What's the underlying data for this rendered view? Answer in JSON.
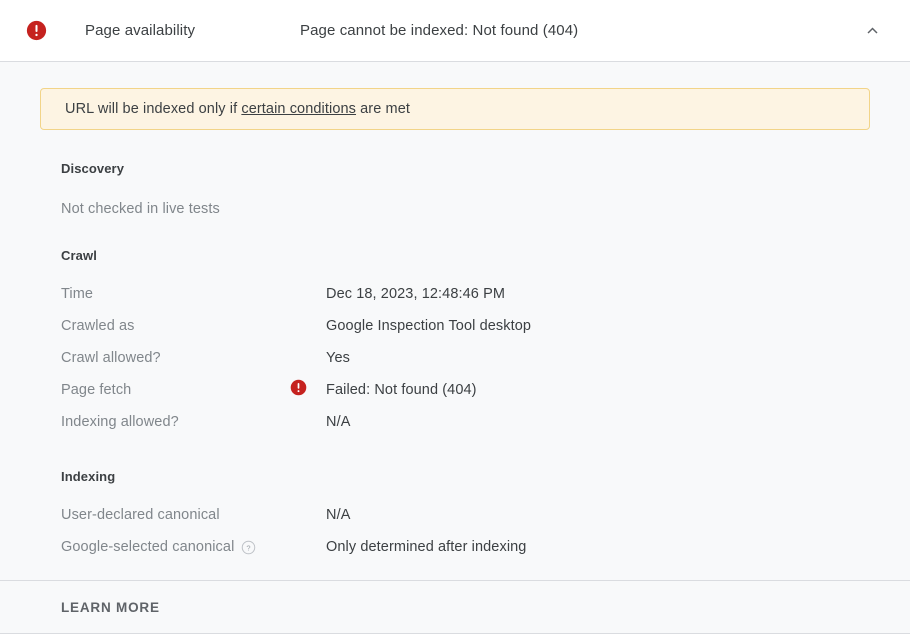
{
  "header": {
    "status_icon": "error-icon",
    "title": "Page availability",
    "status": "Page cannot be indexed: Not found (404)",
    "collapse_icon": "chevron-up-icon"
  },
  "notice": {
    "text_before": "URL will be indexed only if ",
    "link_text": "certain conditions",
    "text_after": " are met"
  },
  "sections": [
    {
      "title": "Discovery",
      "note": "Not checked in live tests"
    },
    {
      "title": "Crawl",
      "rows": [
        {
          "label": "Time",
          "value": "Dec 18, 2023, 12:48:46 PM",
          "status_icon": ""
        },
        {
          "label": "Crawled as",
          "value": "Google Inspection Tool desktop",
          "status_icon": ""
        },
        {
          "label": "Crawl allowed?",
          "value": "Yes",
          "status_icon": ""
        },
        {
          "label": "Page fetch",
          "value": "Failed: Not found (404)",
          "status_icon": "error-icon"
        },
        {
          "label": "Indexing allowed?",
          "value": "N/A",
          "status_icon": ""
        }
      ]
    },
    {
      "title": "Indexing",
      "rows": [
        {
          "label": "User-declared canonical",
          "value": "N/A",
          "status_icon": "",
          "help_icon": ""
        },
        {
          "label": "Google-selected canonical",
          "value": "Only determined after indexing",
          "status_icon": "",
          "help_icon": "help-icon"
        }
      ]
    }
  ],
  "footer": {
    "learn_more": "LEARN MORE"
  },
  "colors": {
    "error_red": "#c5221f",
    "notice_bg": "#fdf4e3",
    "notice_border": "#f2d488",
    "text_primary": "#3c4043",
    "text_secondary": "#80868b",
    "divider": "#dadce0",
    "body_bg": "#f8f9fa"
  }
}
